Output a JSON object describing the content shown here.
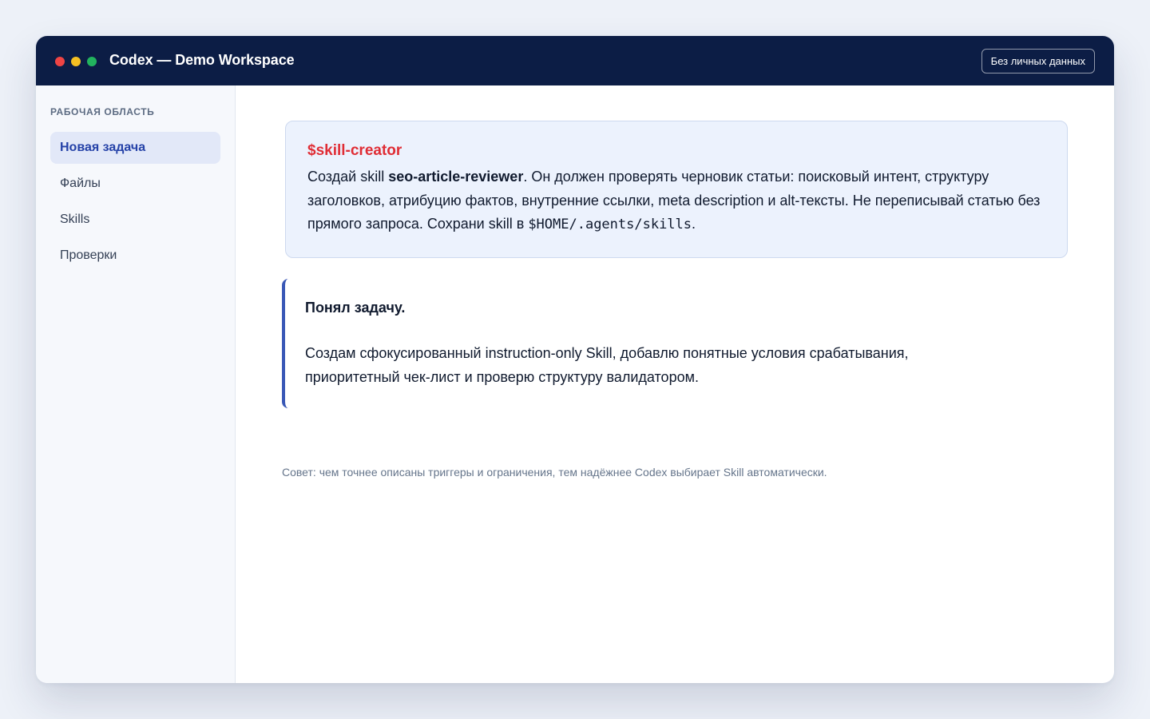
{
  "window": {
    "title": "Codex — Demo Workspace",
    "privacy_badge": "Без личных данных"
  },
  "sidebar": {
    "heading": "РАБОЧАЯ ОБЛАСТЬ",
    "items": [
      {
        "label": "Новая задача",
        "active": true
      },
      {
        "label": "Файлы",
        "active": false
      },
      {
        "label": "Skills",
        "active": false
      },
      {
        "label": "Проверки",
        "active": false
      }
    ]
  },
  "prompt": {
    "skill_tag": "$skill-creator",
    "text_1": "Создай skill ",
    "skill_name": "seo-article-reviewer",
    "text_2": ". Он должен проверять черновик статьи: поисковый интент, структуру заголовков, атрибуцию фактов, внутренние ссылки, meta description и alt-тексты. Не переписывай статью без прямого запроса. Сохрани skill в ",
    "path": "$HOME/.agents/skills",
    "text_3": "."
  },
  "response": {
    "title": "Понял задачу.",
    "text": "Создам сфокусированный instruction-only Skill, добавлю понятные условия срабатывания, приоритетный чек-лист и проверю структуру валидатором."
  },
  "tip": "Совет: чем точнее описаны триггеры и ограничения, тем надёжнее Codex выбирает Skill автоматически.",
  "colors": {
    "titlebar": "#0c1d45",
    "accent": "#2542a8",
    "skill_tag": "#e02d35",
    "window_close": "#ef4444",
    "window_minimize": "#f5c023",
    "window_maximize": "#22b35e"
  }
}
